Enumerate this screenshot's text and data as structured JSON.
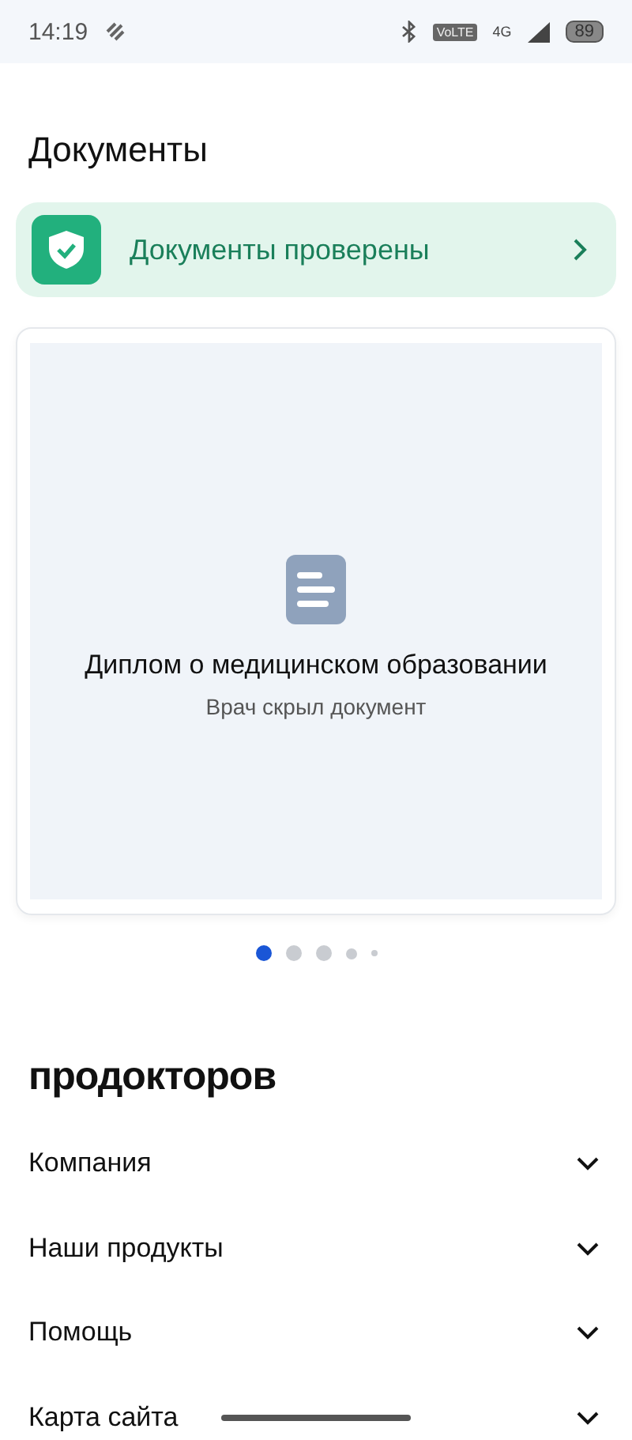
{
  "status_bar": {
    "time": "14:19",
    "network": "VoLTE",
    "signal": "4G",
    "battery": "89"
  },
  "title": "Документы",
  "verified": {
    "label": "Документы проверены"
  },
  "documents": {
    "items": [
      {
        "title": "Диплом о медицинском образовании",
        "subtitle": "Врач скрыл документ"
      }
    ],
    "dots": [
      {
        "selected": true
      },
      {
        "selected": false
      },
      {
        "selected": false
      },
      {
        "selected": false
      },
      {
        "selected": false
      }
    ]
  },
  "footer": {
    "logo": "продокторов",
    "sections": [
      {
        "label": "Компания",
        "expanded": false
      },
      {
        "label": "Наши продукты",
        "expanded": false
      },
      {
        "label": "Помощь",
        "expanded": false
      },
      {
        "label": "Карта сайта",
        "expanded": false
      }
    ]
  }
}
